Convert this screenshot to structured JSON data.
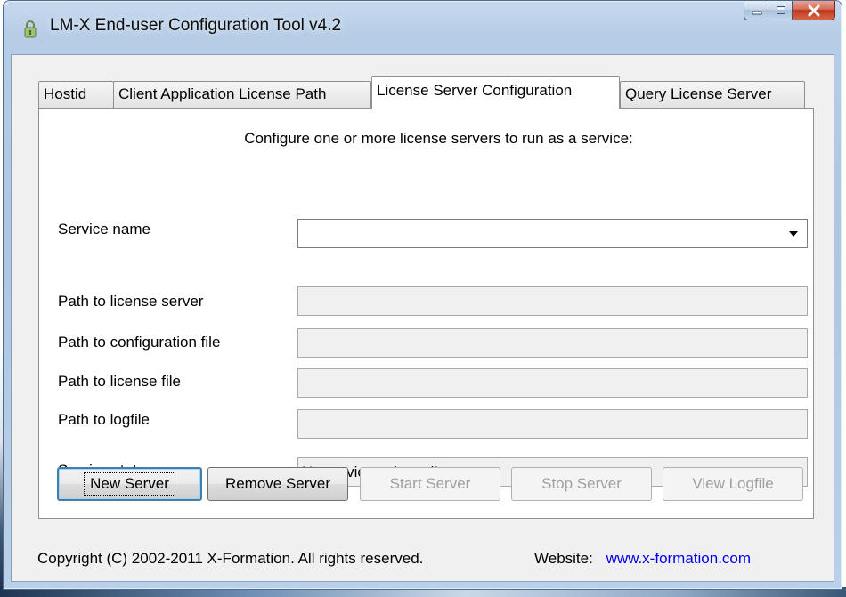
{
  "window": {
    "title": "LM-X End-user Configuration Tool v4.2",
    "title_icon": "lock-icon",
    "caption_buttons": [
      "minimize-icon",
      "maximize-icon",
      "close-icon"
    ]
  },
  "tabs": [
    {
      "label": "Hostid",
      "active": false
    },
    {
      "label": "Client Application License Path",
      "active": false
    },
    {
      "label": "License Server Configuration",
      "active": true
    },
    {
      "label": "Query License Server",
      "active": false
    }
  ],
  "panel": {
    "intro": "Configure one or more license servers to run as a service:",
    "service_name": {
      "label": "Service name",
      "value": ""
    },
    "path_license_server": {
      "label": "Path to license server",
      "value": ""
    },
    "path_config_file": {
      "label": "Path to configuration file",
      "value": ""
    },
    "path_license_file": {
      "label": "Path to license file",
      "value": ""
    },
    "path_logfile": {
      "label": "Path to logfile",
      "value": ""
    },
    "service_status": {
      "label": "Service status",
      "value": "No service selected!"
    }
  },
  "buttons": {
    "new_server": "New Server",
    "remove_server": "Remove Server",
    "start_server": "Start Server",
    "stop_server": "Stop Server",
    "view_logfile": "View Logfile"
  },
  "footer": {
    "copyright": "Copyright (C) 2002-2011 X-Formation. All rights reserved.",
    "website_label": "Website:",
    "website_link": "www.x-formation.com"
  },
  "colors": {
    "link": "#0000ee",
    "close_button": "#c1391d",
    "default_button_border": "#3c7fb1"
  }
}
